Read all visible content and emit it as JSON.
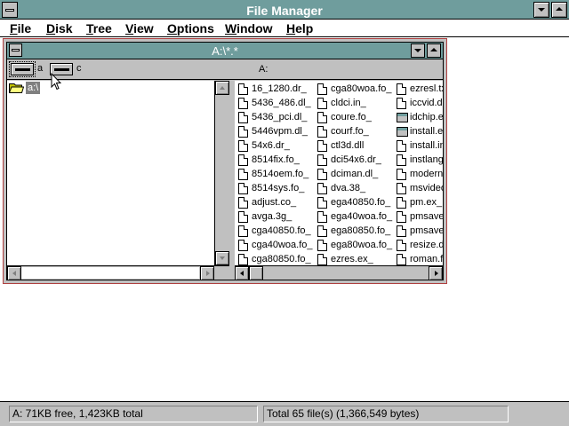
{
  "window": {
    "title": "File Manager"
  },
  "menu": [
    {
      "label": "File",
      "underline": "F",
      "rest": "ile"
    },
    {
      "label": "Disk",
      "underline": "D",
      "rest": "isk"
    },
    {
      "label": "Tree",
      "underline": "T",
      "rest": "ree"
    },
    {
      "label": "View",
      "underline": "V",
      "rest": "iew"
    },
    {
      "label": "Options",
      "underline": "O",
      "rest": "ptions"
    },
    {
      "label": "Window",
      "underline": "W",
      "rest": "indow"
    },
    {
      "label": "Help",
      "underline": "H",
      "rest": "elp"
    }
  ],
  "child": {
    "title": "A:\\*.*",
    "drives": [
      {
        "label": "a",
        "selected": true
      },
      {
        "label": "c",
        "selected": false
      }
    ],
    "volume": "A:",
    "tree": {
      "root_label": "a:\\"
    },
    "files": {
      "columns": [
        [
          {
            "name": "16_1280.dr_",
            "icon": "document-icon"
          },
          {
            "name": "5436_486.dl_",
            "icon": "document-icon"
          },
          {
            "name": "5436_pci.dl_",
            "icon": "document-icon"
          },
          {
            "name": "5446vpm.dl_",
            "icon": "document-icon"
          },
          {
            "name": "54x6.dr_",
            "icon": "document-icon"
          },
          {
            "name": "8514fix.fo_",
            "icon": "document-icon"
          },
          {
            "name": "8514oem.fo_",
            "icon": "document-icon"
          },
          {
            "name": "8514sys.fo_",
            "icon": "document-icon"
          },
          {
            "name": "adjust.co_",
            "icon": "document-icon"
          },
          {
            "name": "avga.3g_",
            "icon": "document-icon"
          },
          {
            "name": "cga40850.fo_",
            "icon": "document-icon"
          },
          {
            "name": "cga40woa.fo_",
            "icon": "document-icon"
          },
          {
            "name": "cga80850.fo_",
            "icon": "document-icon"
          }
        ],
        [
          {
            "name": "cga80woa.fo_",
            "icon": "document-icon"
          },
          {
            "name": "cldci.in_",
            "icon": "document-icon"
          },
          {
            "name": "coure.fo_",
            "icon": "document-icon"
          },
          {
            "name": "courf.fo_",
            "icon": "document-icon"
          },
          {
            "name": "ctl3d.dll",
            "icon": "document-icon"
          },
          {
            "name": "dci54x6.dr_",
            "icon": "document-icon"
          },
          {
            "name": "dciman.dl_",
            "icon": "document-icon"
          },
          {
            "name": "dva.38_",
            "icon": "document-icon"
          },
          {
            "name": "ega40850.fo_",
            "icon": "document-icon"
          },
          {
            "name": "ega40woa.fo_",
            "icon": "document-icon"
          },
          {
            "name": "ega80850.fo_",
            "icon": "document-icon"
          },
          {
            "name": "ega80woa.fo_",
            "icon": "document-icon"
          },
          {
            "name": "ezres.ex_",
            "icon": "document-icon"
          }
        ],
        [
          {
            "name": "ezresl.tx",
            "icon": "document-icon"
          },
          {
            "name": "iccvid.dr",
            "icon": "document-icon"
          },
          {
            "name": "idchip.ex",
            "icon": "application-icon"
          },
          {
            "name": "install.ex",
            "icon": "application-icon"
          },
          {
            "name": "install.inf",
            "icon": "document-icon"
          },
          {
            "name": "instlang.",
            "icon": "document-icon"
          },
          {
            "name": "modern.f",
            "icon": "document-icon"
          },
          {
            "name": "msvideo",
            "icon": "document-icon"
          },
          {
            "name": "pm.ex_",
            "icon": "document-icon"
          },
          {
            "name": "pmsaver",
            "icon": "document-icon"
          },
          {
            "name": "pmsaver",
            "icon": "document-icon"
          },
          {
            "name": "resize.dl",
            "icon": "document-icon"
          },
          {
            "name": "roman.fo",
            "icon": "document-icon"
          }
        ]
      ]
    }
  },
  "status": {
    "left": "A: 71KB free,  1,423KB total",
    "right": "Total 65 file(s) (1,366,549 bytes)"
  },
  "colors": {
    "titlebar": "#6f9d9d",
    "window_frame": "#c0c0c0",
    "selection": "#808080",
    "child_border": "#b04040"
  }
}
